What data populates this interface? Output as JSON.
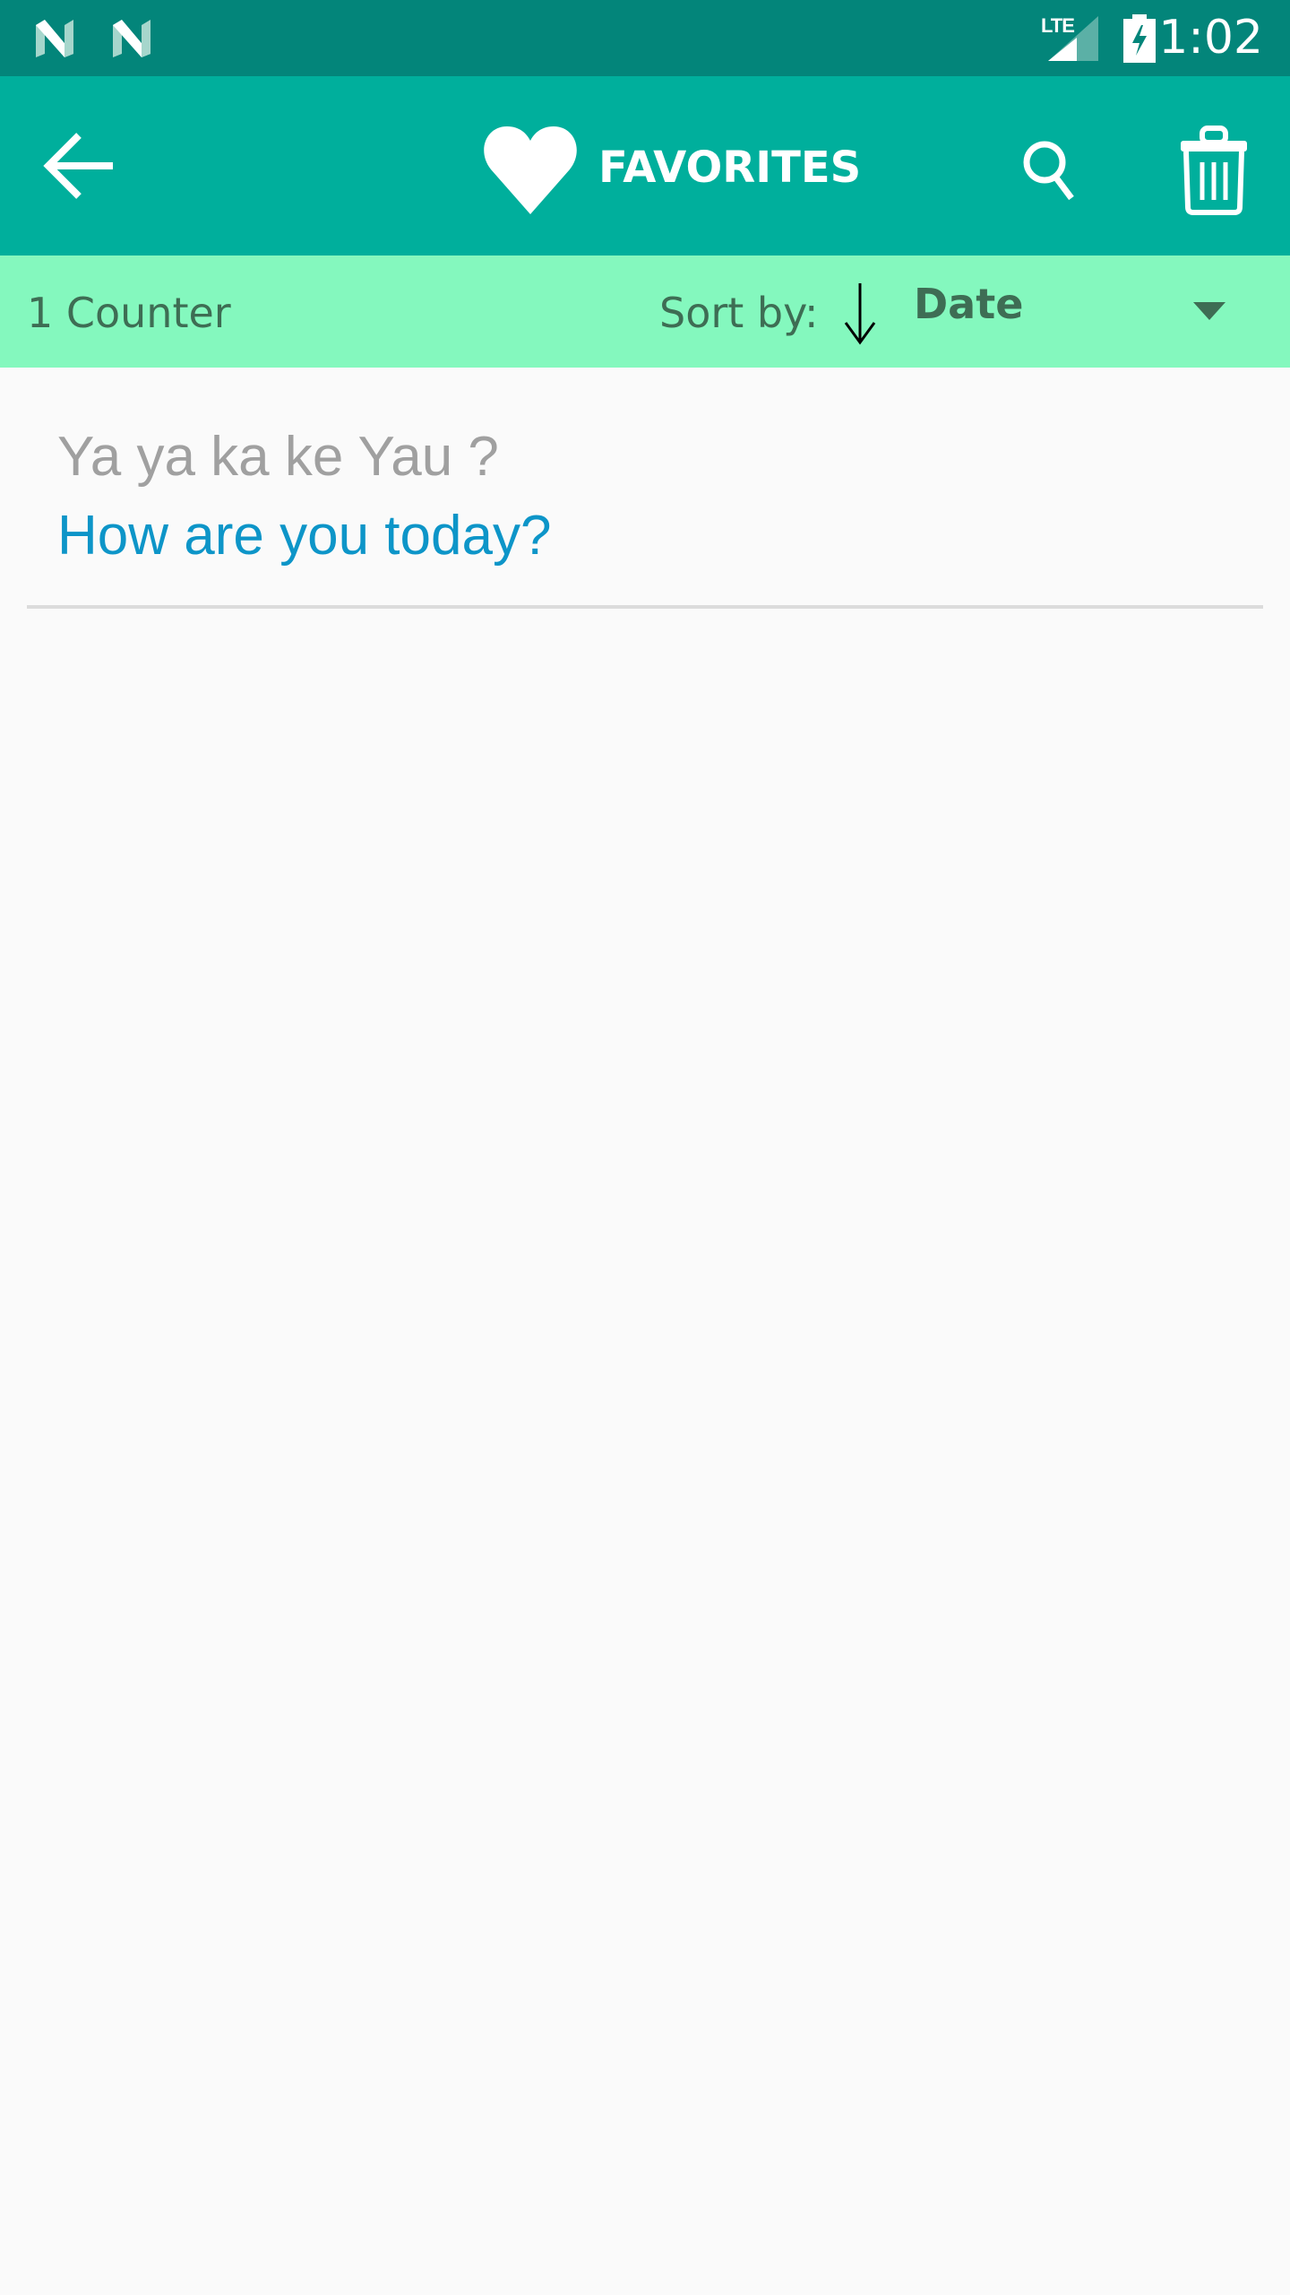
{
  "status_bar": {
    "notification_icons": [
      "android-n-icon",
      "android-n-icon"
    ],
    "network_label": "LTE",
    "time": "1:02",
    "colors": {
      "background": "#03857a"
    }
  },
  "app_bar": {
    "title": "FAVORITES",
    "title_icon": "heart-icon",
    "back_icon": "arrow-left-icon",
    "actions": [
      "search-icon",
      "trash-icon"
    ],
    "colors": {
      "background": "#00af9c"
    }
  },
  "sort_bar": {
    "count_label": "1 Counter",
    "sort_label": "Sort by:",
    "sort_direction_icon": "arrow-down-icon",
    "sort_value": "Date",
    "dropdown_icon": "caret-down-icon",
    "colors": {
      "background": "#84f8be",
      "text": "#3e6d54"
    }
  },
  "favorites": [
    {
      "source": "Ya ya ka ke Yau ?",
      "translation": "How are you today?"
    }
  ],
  "colors": {
    "source_text": "#a0a0a0",
    "translation_text": "#0d95c8"
  }
}
